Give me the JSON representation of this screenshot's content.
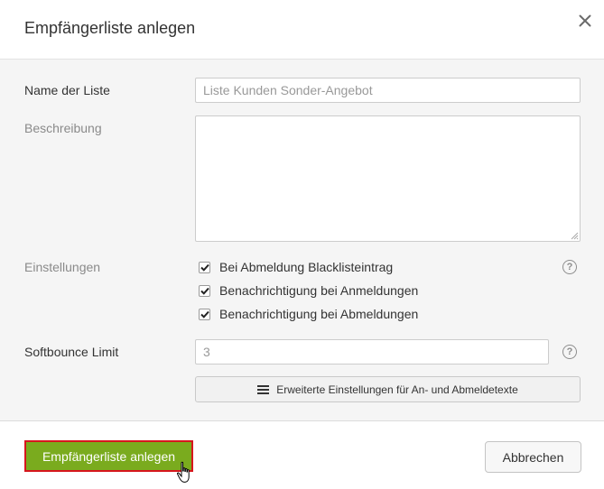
{
  "dialog": {
    "title": "Empfängerliste anlegen",
    "close_icon": "close-icon"
  },
  "form": {
    "name": {
      "label": "Name der Liste",
      "placeholder": "Liste Kunden Sonder-Angebot",
      "value": ""
    },
    "description": {
      "label": "Beschreibung",
      "value": ""
    },
    "settings": {
      "label": "Einstellungen",
      "options": [
        {
          "label": "Bei Abmeldung Blacklisteintrag",
          "checked": true
        },
        {
          "label": "Benachrichtigung bei Anmeldungen",
          "checked": true
        },
        {
          "label": "Benachrichtigung bei Abmeldungen",
          "checked": true
        }
      ],
      "help_icon": "question-circle-icon"
    },
    "softbounce": {
      "label": "Softbounce Limit",
      "placeholder": "3",
      "value": "",
      "help_icon": "question-circle-icon"
    },
    "advanced_button": {
      "label": "Erweiterte Einstellungen für An- und Abmeldetexte",
      "icon": "menu-lines-icon"
    }
  },
  "footer": {
    "submit_label": "Empfängerliste anlegen",
    "cancel_label": "Abbrechen"
  },
  "colors": {
    "primary": "#7aab1e",
    "highlight_border": "#d6161d",
    "body_background": "#f5f5f5"
  }
}
